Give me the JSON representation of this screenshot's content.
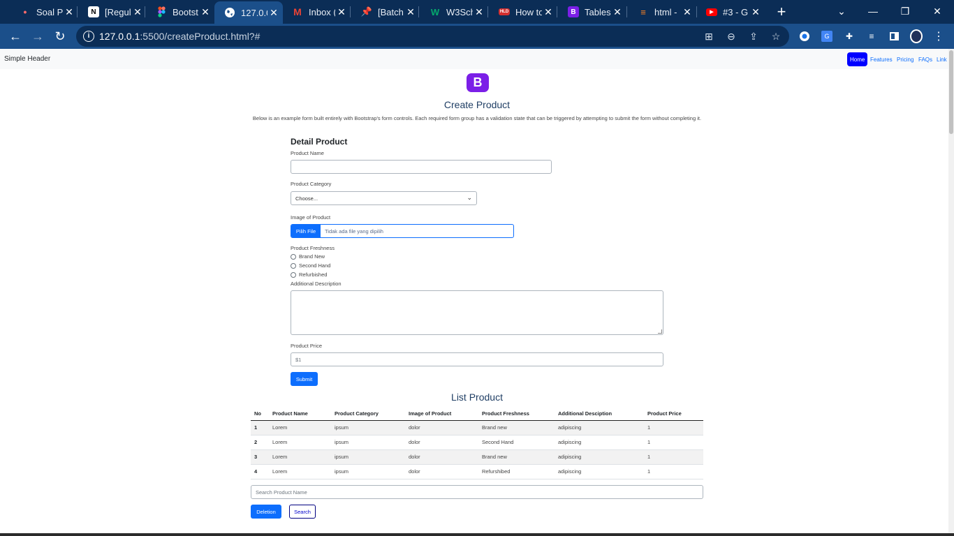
{
  "browser": {
    "tabs": [
      {
        "title": "Soal Pi",
        "icon": "dot-icon",
        "active": false
      },
      {
        "title": "[Regul",
        "icon": "notion-icon",
        "active": false
      },
      {
        "title": "Bootst",
        "icon": "figma-icon",
        "active": false
      },
      {
        "title": "127.0.0",
        "icon": "globe-icon",
        "active": true
      },
      {
        "title": "Inbox (",
        "icon": "gmail-icon",
        "active": false
      },
      {
        "title": "[Batch",
        "icon": "pin-icon",
        "active": false
      },
      {
        "title": "W3Sch",
        "icon": "w3schools-icon",
        "active": false
      },
      {
        "title": "How to",
        "icon": "hld-icon",
        "active": false
      },
      {
        "title": "Tables",
        "icon": "bootstrap-icon",
        "active": false
      },
      {
        "title": "html -",
        "icon": "stackoverflow-icon",
        "active": false
      },
      {
        "title": "#3 - G",
        "icon": "youtube-icon",
        "active": false
      }
    ],
    "url_host": "127.0.0.1",
    "url_path": ":5500/createProduct.html?#"
  },
  "header": {
    "brand": "Simple Header",
    "nav": [
      {
        "label": "Home",
        "active": true
      },
      {
        "label": "Features",
        "active": false
      },
      {
        "label": "Pricing",
        "active": false
      },
      {
        "label": "FAQs",
        "active": false
      },
      {
        "label": "Link",
        "active": false
      }
    ]
  },
  "hero": {
    "logo_letter": "B",
    "title": "Create Product",
    "lead": "Below is an example form built entirely with Bootstrap's form controls. Each required form group has a validation state that can be triggered by attempting to submit the form without completing it."
  },
  "form": {
    "section_title": "Detail Product",
    "product_name_label": "Product Name",
    "product_name_value": "",
    "category_label": "Product Category",
    "category_selected": "Choose...",
    "image_label": "Image of Product",
    "file_button": "Pilih File",
    "file_status": "Tidak ada file yang dipilih",
    "freshness_label": "Product Freshness",
    "freshness_options": [
      "Brand New",
      "Second Hand",
      "Refurbished"
    ],
    "description_label": "Additional Description",
    "price_label": "Product Price",
    "price_placeholder": "$1",
    "submit": "Submit"
  },
  "list": {
    "title": "List Product",
    "columns": [
      "No",
      "Product Name",
      "Product Category",
      "Image of Product",
      "Product Freshness",
      "Additional Desciption",
      "Product Price"
    ],
    "rows": [
      [
        "1",
        "Lorem",
        "ipsum",
        "dolor",
        "Brand new",
        "adipiscing",
        "1"
      ],
      [
        "2",
        "Lorem",
        "ipsum",
        "dolor",
        "Second Hand",
        "adipiscing",
        "1"
      ],
      [
        "3",
        "Lorem",
        "ipsum",
        "dolor",
        "Brand new",
        "adipiscing",
        "1"
      ],
      [
        "4",
        "Lorem",
        "ipsum",
        "dolor",
        "Refurshibed",
        "adipiscing",
        "1"
      ]
    ],
    "search_placeholder": "Search Product Name",
    "delete_button": "Deletion",
    "search_button": "Search"
  },
  "colors": {
    "accent": "#0d6efd",
    "chrome_dark": "#0b2d56",
    "chrome_toolbar": "#1b4f8a",
    "logo": "#7b1fe7"
  }
}
